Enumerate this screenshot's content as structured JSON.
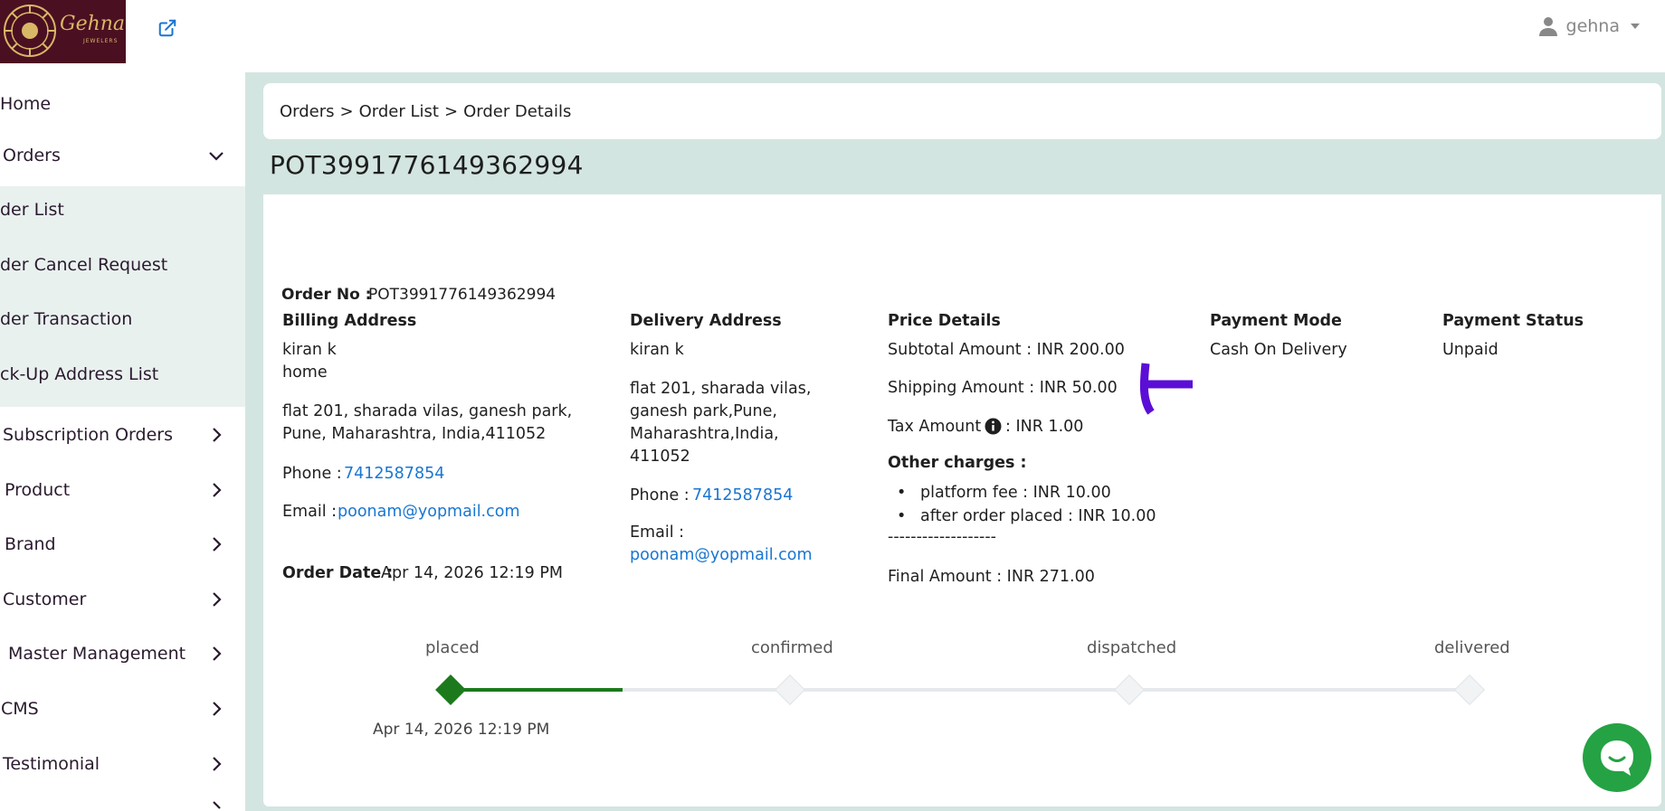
{
  "header": {
    "brand": "Gehna",
    "brand_sub": "JEWELERS",
    "user_name": "gehna"
  },
  "sidebar": {
    "items": [
      {
        "label": "Home"
      },
      {
        "label": "Orders"
      },
      {
        "label": "der List"
      },
      {
        "label": "der Cancel Request"
      },
      {
        "label": "der Transaction"
      },
      {
        "label": "ck-Up Address List"
      },
      {
        "label": "Subscription Orders"
      },
      {
        "label": "Product"
      },
      {
        "label": "Brand"
      },
      {
        "label": "Customer"
      },
      {
        "label": "Master Management"
      },
      {
        "label": "CMS"
      },
      {
        "label": "Testimonial"
      }
    ]
  },
  "breadcrumb": {
    "path": [
      "Orders",
      "Order List",
      "Order Details"
    ],
    "separator": ">"
  },
  "order": {
    "title": "POT3991776149362994",
    "order_no_label": "Order No :",
    "order_no": "POT3991776149362994",
    "billing": {
      "heading": "Billing Address",
      "name": "kiran k",
      "type": "home",
      "address": "flat 201, sharada vilas, ganesh park, Pune, Maharashtra, India,411052",
      "phone_label": "Phone :",
      "phone": "7412587854",
      "email_label": "Email :",
      "email": "poonam@yopmail.com"
    },
    "order_date_label": "Order Date :",
    "order_date": "Apr 14, 2026 12:19 PM",
    "delivery": {
      "heading": "Delivery Address",
      "name": "kiran k",
      "address": "flat 201, sharada vilas, ganesh park,Pune, Maharashtra,India, 411052",
      "phone_label": "Phone :",
      "phone": "7412587854",
      "email_label": "Email :",
      "email": "poonam@yopmail.com"
    },
    "price": {
      "heading": "Price Details",
      "subtotal": "Subtotal Amount : INR 200.00",
      "shipping": "Shipping Amount : INR 50.00",
      "tax_label": "Tax Amount",
      "tax_value": ": INR  1.00",
      "other_heading": "Other charges :",
      "other": [
        "platform fee :  INR  10.00",
        "after order placed :  INR  10.00"
      ],
      "divider1": "-------------------",
      "final": "Final Amount : INR  271.00",
      "divider2": "--------------------"
    },
    "payment_mode": {
      "heading": "Payment Mode",
      "value": "Cash On Delivery"
    },
    "payment_status": {
      "heading": "Payment Status",
      "value": "Unpaid"
    }
  },
  "timeline": {
    "steps": [
      "placed",
      "confirmed",
      "dispatched",
      "delivered"
    ],
    "completed_date": "Apr 14, 2026 12:19 PM",
    "active_color": "#1c7a1c",
    "pending_color": "#e6e9ec"
  },
  "colors": {
    "link": "#1976d2",
    "main_bg": "#d3e5e0",
    "submenu_bg": "#e9f1ef",
    "brand_bg": "#4b0f22",
    "annotation": "#5b0fd6",
    "chat": "#25a244"
  },
  "icons": {
    "external_link": "external-link-icon",
    "user": "user-icon",
    "info": "info-icon",
    "chat": "chat-icon"
  }
}
